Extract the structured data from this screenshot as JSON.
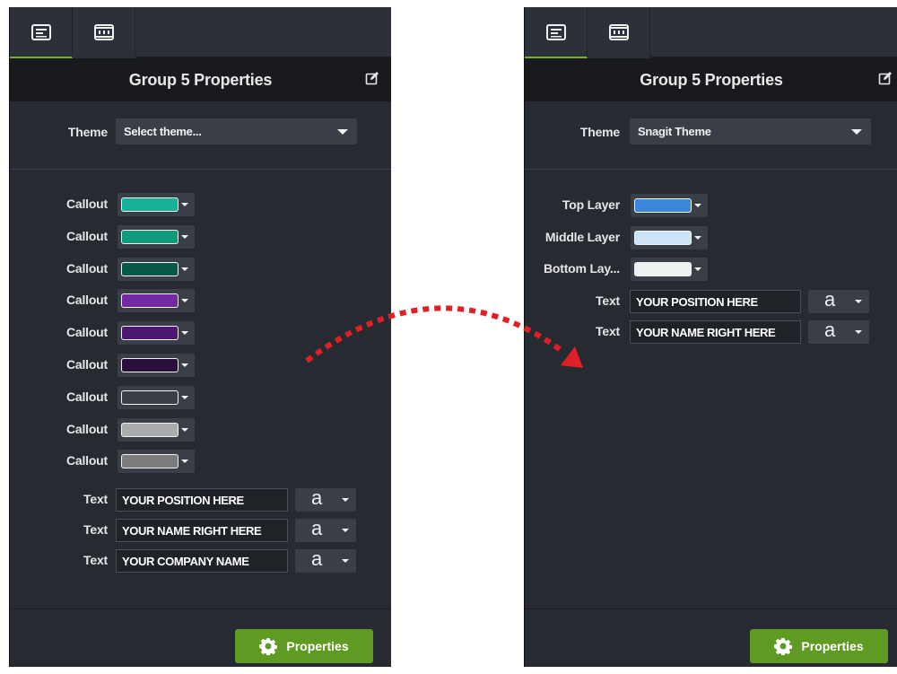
{
  "left_panel": {
    "title": "Group 5 Properties",
    "theme_label": "Theme",
    "theme_value": "Select theme...",
    "color_rows": [
      {
        "label": "Callout",
        "color": "#16b398"
      },
      {
        "label": "Callout",
        "color": "#0e9b7c"
      },
      {
        "label": "Callout",
        "color": "#075948"
      },
      {
        "label": "Callout",
        "color": "#7229a3"
      },
      {
        "label": "Callout",
        "color": "#4d1873"
      },
      {
        "label": "Callout",
        "color": "#2a0f3d"
      },
      {
        "label": "Callout",
        "color": "#3b3f46"
      },
      {
        "label": "Callout",
        "color": "#a9abad"
      },
      {
        "label": "Callout",
        "color": "#7c7c7e"
      }
    ],
    "text_rows": [
      {
        "label": "Text",
        "value": "YOUR POSITION HERE",
        "font_glyph": "a"
      },
      {
        "label": "Text",
        "value": "YOUR NAME RIGHT HERE",
        "font_glyph": "a"
      },
      {
        "label": "Text",
        "value": "YOUR COMPANY NAME",
        "font_glyph": "a"
      }
    ],
    "button_label": "Properties"
  },
  "right_panel": {
    "title": "Group 5 Properties",
    "theme_label": "Theme",
    "theme_value": "Snagit Theme",
    "color_rows": [
      {
        "label": "Top Layer",
        "color": "#3a86d8"
      },
      {
        "label": "Middle Layer",
        "color": "#cde4f8"
      },
      {
        "label": "Bottom Lay...",
        "color": "#eef1f2"
      }
    ],
    "text_rows": [
      {
        "label": "Text",
        "value": "YOUR POSITION HERE",
        "font_glyph": "a"
      },
      {
        "label": "Text",
        "value": "YOUR NAME RIGHT HERE",
        "font_glyph": "a"
      }
    ],
    "button_label": "Properties"
  },
  "colors": {
    "accent_green": "#5f9b22",
    "tab_underline": "#74b32b",
    "arrow": "#e11f26"
  },
  "icons": {
    "tab1": "properties-panel-icon",
    "tab2": "film-strip-icon",
    "edit": "edit-pencil-icon",
    "button": "gear-icon"
  }
}
